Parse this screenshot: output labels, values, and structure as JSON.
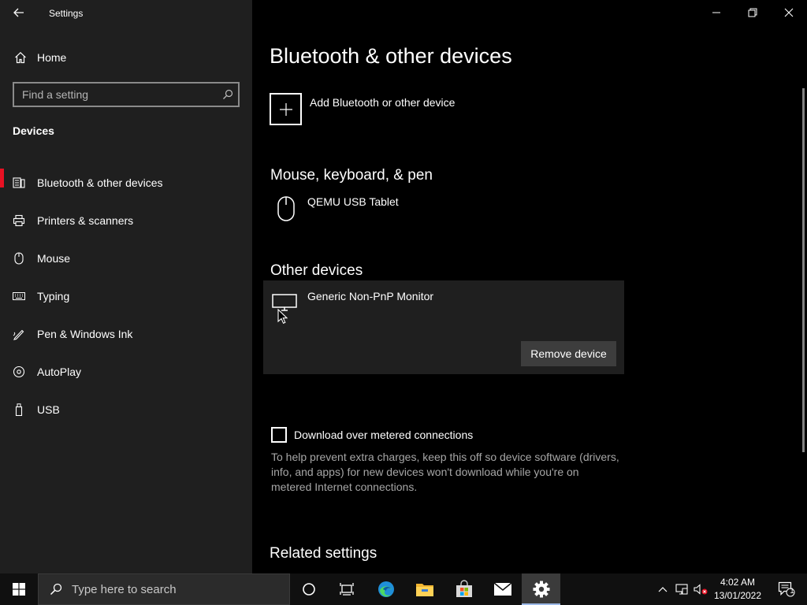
{
  "window": {
    "title": "Settings"
  },
  "sidebar": {
    "home_label": "Home",
    "search_placeholder": "Find a setting",
    "section_label": "Devices",
    "items": [
      {
        "label": "Bluetooth & other devices",
        "icon": "bluetooth-devices-icon",
        "active": true
      },
      {
        "label": "Printers & scanners",
        "icon": "printer-icon",
        "active": false
      },
      {
        "label": "Mouse",
        "icon": "mouse-icon",
        "active": false
      },
      {
        "label": "Typing",
        "icon": "keyboard-icon",
        "active": false
      },
      {
        "label": "Pen & Windows Ink",
        "icon": "pen-icon",
        "active": false
      },
      {
        "label": "AutoPlay",
        "icon": "autoplay-icon",
        "active": false
      },
      {
        "label": "USB",
        "icon": "usb-icon",
        "active": false
      }
    ]
  },
  "main": {
    "title": "Bluetooth & other devices",
    "add_device_label": "Add Bluetooth or other device",
    "mouse_section": {
      "heading": "Mouse, keyboard, & pen",
      "devices": [
        {
          "name": "QEMU USB Tablet",
          "icon": "mouse-icon"
        }
      ]
    },
    "other_section": {
      "heading": "Other devices",
      "devices": [
        {
          "name": "Generic Non-PnP Monitor",
          "icon": "monitor-icon",
          "selected": true
        }
      ],
      "remove_button": "Remove device"
    },
    "metered": {
      "label": "Download over metered connections",
      "checked": false,
      "description": "To help prevent extra charges, keep this off so device software (drivers, info, and apps) for new devices won't download while you're on metered Internet connections."
    },
    "related_heading": "Related settings"
  },
  "taskbar": {
    "search_placeholder": "Type here to search",
    "pinned": [
      "cortana-icon",
      "task-view-icon",
      "edge-icon",
      "file-explorer-icon",
      "store-icon",
      "mail-icon",
      "settings-icon"
    ],
    "time": "4:02 AM",
    "date": "13/01/2022",
    "notification_count": "1"
  },
  "colors": {
    "accent_active": "#e81123",
    "sidebar_bg": "#1f1f1f",
    "main_bg": "#000000",
    "taskbar_bg": "#101010",
    "muted_text": "#a6a6a6"
  }
}
